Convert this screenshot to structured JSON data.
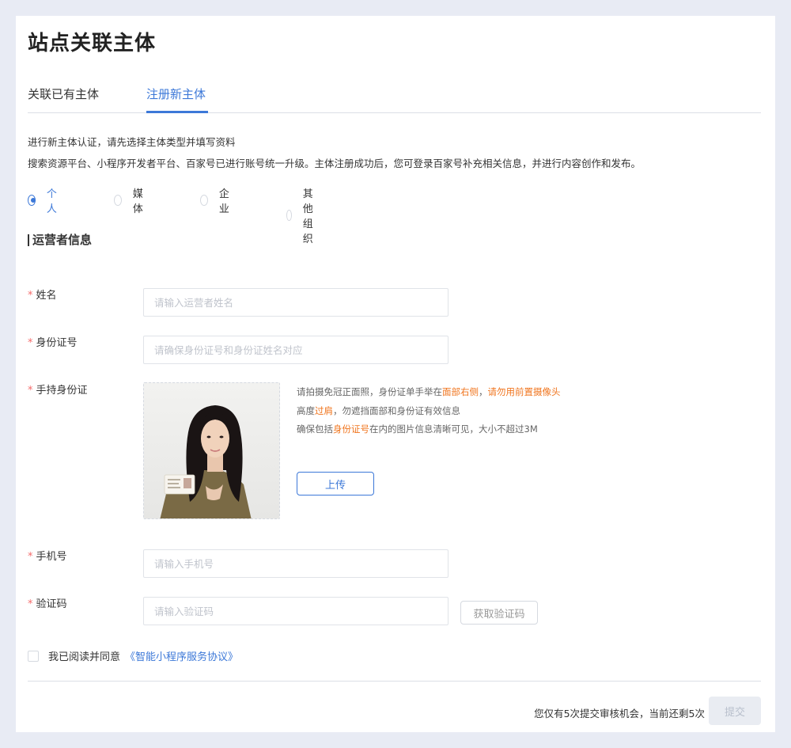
{
  "page": {
    "title": "站点关联主体"
  },
  "tabs": [
    {
      "label": "关联已有主体",
      "active": false
    },
    {
      "label": "注册新主体",
      "active": true
    }
  ],
  "intro": {
    "line1": "进行新主体认证，请先选择主体类型并填写资料",
    "line2": "搜索资源平台、小程序开发者平台、百家号已进行账号统一升级。主体注册成功后，您可登录百家号补充相关信息，并进行内容创作和发布。"
  },
  "entity_types": {
    "options": [
      "个人",
      "媒体",
      "企业",
      "其他组织"
    ],
    "selected": "个人"
  },
  "section": {
    "title": "运营者信息"
  },
  "form": {
    "required_mark": "*",
    "name": {
      "label": "姓名",
      "placeholder": "请输入运营者姓名",
      "value": ""
    },
    "id_number": {
      "label": "身份证号",
      "placeholder": "请确保身份证号和身份证姓名对应",
      "value": ""
    },
    "id_photo": {
      "label": "手持身份证",
      "hint1_a": "请拍摄免冠正面照，身份证单手举在",
      "hint1_b": "面部右侧",
      "hint1_c": "，",
      "hint1_d": "请勿用前置摄像头",
      "hint2_a": "高度",
      "hint2_b": "过肩",
      "hint2_c": "，勿遮挡面部和身份证有效信息",
      "hint3_a": "确保包括",
      "hint3_b": "身份证号",
      "hint3_c": "在内的图片信息清晰可见，大小不超过3M",
      "upload_label": "上传"
    },
    "phone": {
      "label": "手机号",
      "placeholder": "请输入手机号",
      "value": ""
    },
    "code": {
      "label": "验证码",
      "placeholder": "请输入验证码",
      "value": "",
      "button_label": "获取验证码"
    }
  },
  "agreement": {
    "text": "我已阅读并同意",
    "link": "《智能小程序服务协议》",
    "checked": false
  },
  "footer": {
    "chances": "您仅有5次提交审核机会，当前还剩5次",
    "submit_label": "提交"
  },
  "colors": {
    "accent": "#3c78d8",
    "required": "#f56c6c",
    "highlight": "#f0751e",
    "background": "#e8ebf4"
  }
}
